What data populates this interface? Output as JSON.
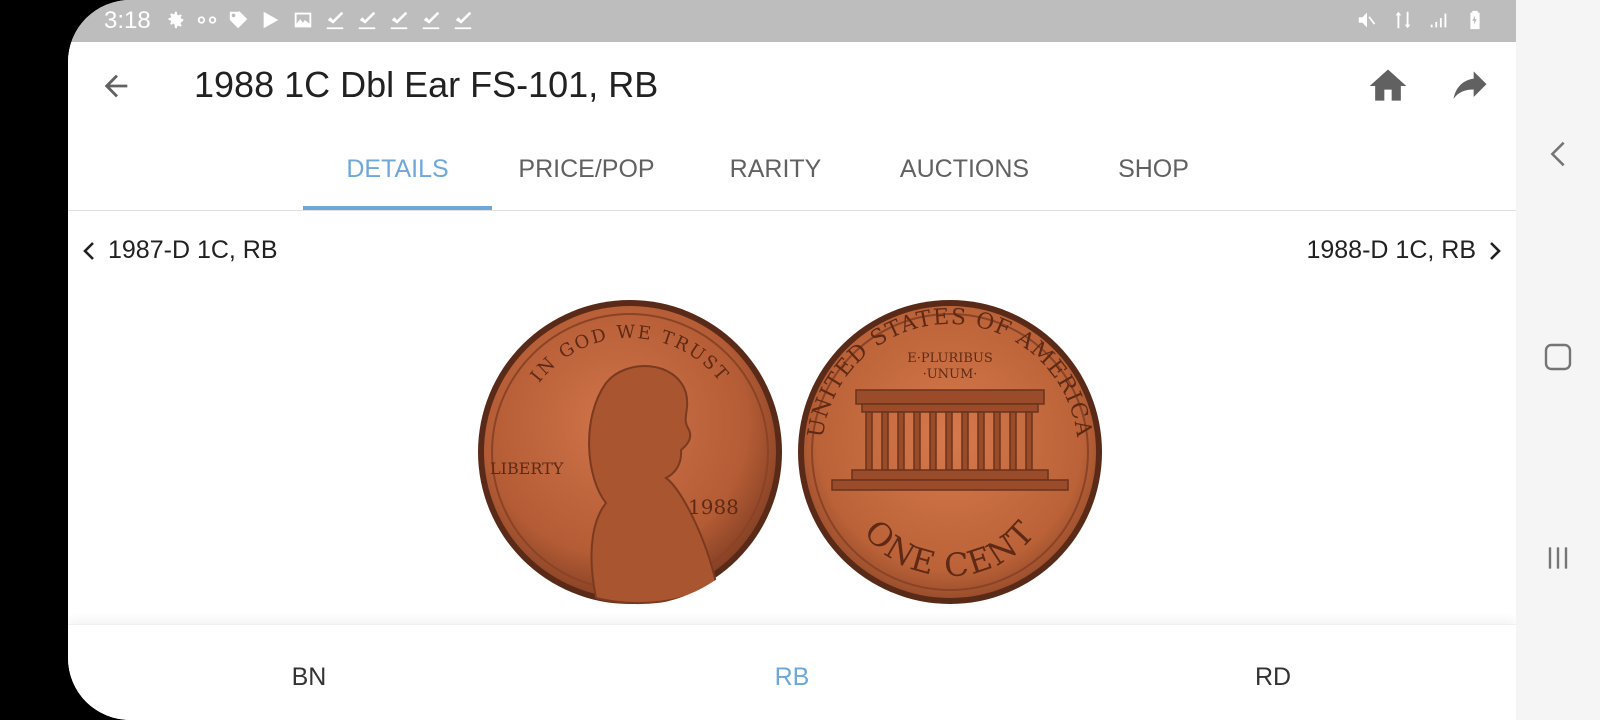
{
  "status_bar": {
    "time": "3:18",
    "left_icons": [
      "gear-icon",
      "voicemail-icon",
      "tag-icon",
      "play-store-icon",
      "image-icon",
      "check-icon",
      "check-icon",
      "check-icon",
      "check-icon",
      "check-icon"
    ],
    "right_icons": [
      "mute-icon",
      "data-icon",
      "signal-icon",
      "battery-icon"
    ]
  },
  "app_bar": {
    "title": "1988 1C Dbl Ear FS-101, RB"
  },
  "tabs": [
    {
      "label": "DETAILS",
      "active": true
    },
    {
      "label": "PRICE/POP",
      "active": false
    },
    {
      "label": "RARITY",
      "active": false
    },
    {
      "label": "AUCTIONS",
      "active": false
    },
    {
      "label": "SHOP",
      "active": false
    }
  ],
  "coin_nav": {
    "previous": "1987-D 1C, RB",
    "next": "1988-D 1C, RB"
  },
  "coin_images": {
    "obverse": {
      "legend": "IN GOD WE TRUST",
      "liberty": "LIBERTY",
      "year": "1988"
    },
    "reverse": {
      "legend": "UNITED STATES OF AMERICA",
      "motto_line1": "E·PLURIBUS",
      "motto_line2": "·UNUM·",
      "denomination": "ONE CENT"
    }
  },
  "grades": [
    {
      "label": "BN",
      "active": false
    },
    {
      "label": "RB",
      "active": true
    },
    {
      "label": "RD",
      "active": false
    }
  ],
  "colors": {
    "accent": "#6ea7d8",
    "status_bar": "#bdbdbd",
    "copper": "#b8623a"
  }
}
